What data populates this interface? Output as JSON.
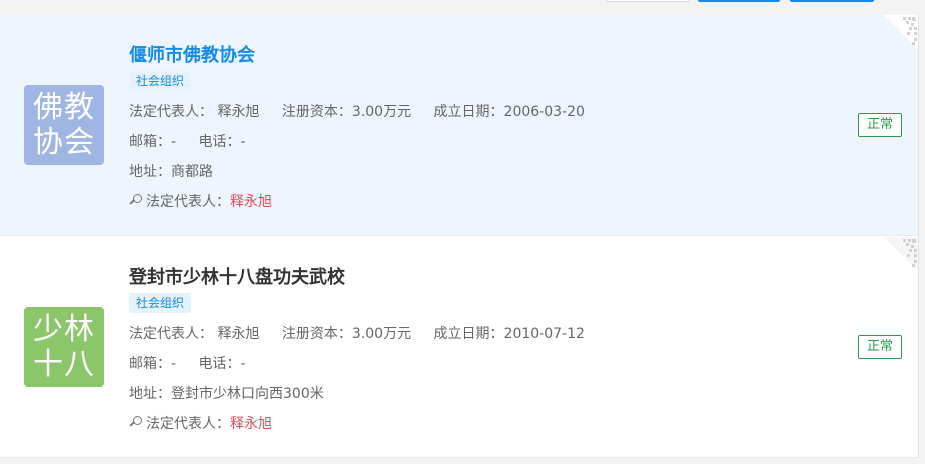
{
  "companies": [
    {
      "name": "偃师市佛教协会",
      "logo_lines": [
        "佛教",
        "协会"
      ],
      "tag": "社会组织",
      "legal_rep_label": "法定代表人：",
      "legal_rep": "释永旭",
      "capital_label": "注册资本：",
      "capital": "3.00万元",
      "founded_label": "成立日期：",
      "founded": "2006-03-20",
      "email_label": "邮箱：",
      "email": "-",
      "phone_label": "电话：",
      "phone": "-",
      "address_label": "地址：",
      "address": "商都路",
      "match_label": "法定代表人：",
      "match_value": "释永旭",
      "status": "正常"
    },
    {
      "name": "登封市少林十八盘功夫武校",
      "logo_lines": [
        "少林",
        "十八"
      ],
      "tag": "社会组织",
      "legal_rep_label": "法定代表人：",
      "legal_rep": "释永旭",
      "capital_label": "注册资本：",
      "capital": "3.00万元",
      "founded_label": "成立日期：",
      "founded": "2010-07-12",
      "email_label": "邮箱：",
      "email": "-",
      "phone_label": "电话：",
      "phone": "-",
      "address_label": "地址：",
      "address": "登封市少林口向西300米",
      "match_label": "法定代表人：",
      "match_value": "释永旭",
      "status": "正常"
    }
  ],
  "colors": {
    "accent": "#128bed",
    "status_green": "#2a9b4a",
    "highlight_red": "#e64a56",
    "logo0_bg": "#9fb5e2",
    "logo1_bg": "#8bc76a"
  },
  "icons": [
    "search-icon",
    "qr-code-icon"
  ]
}
